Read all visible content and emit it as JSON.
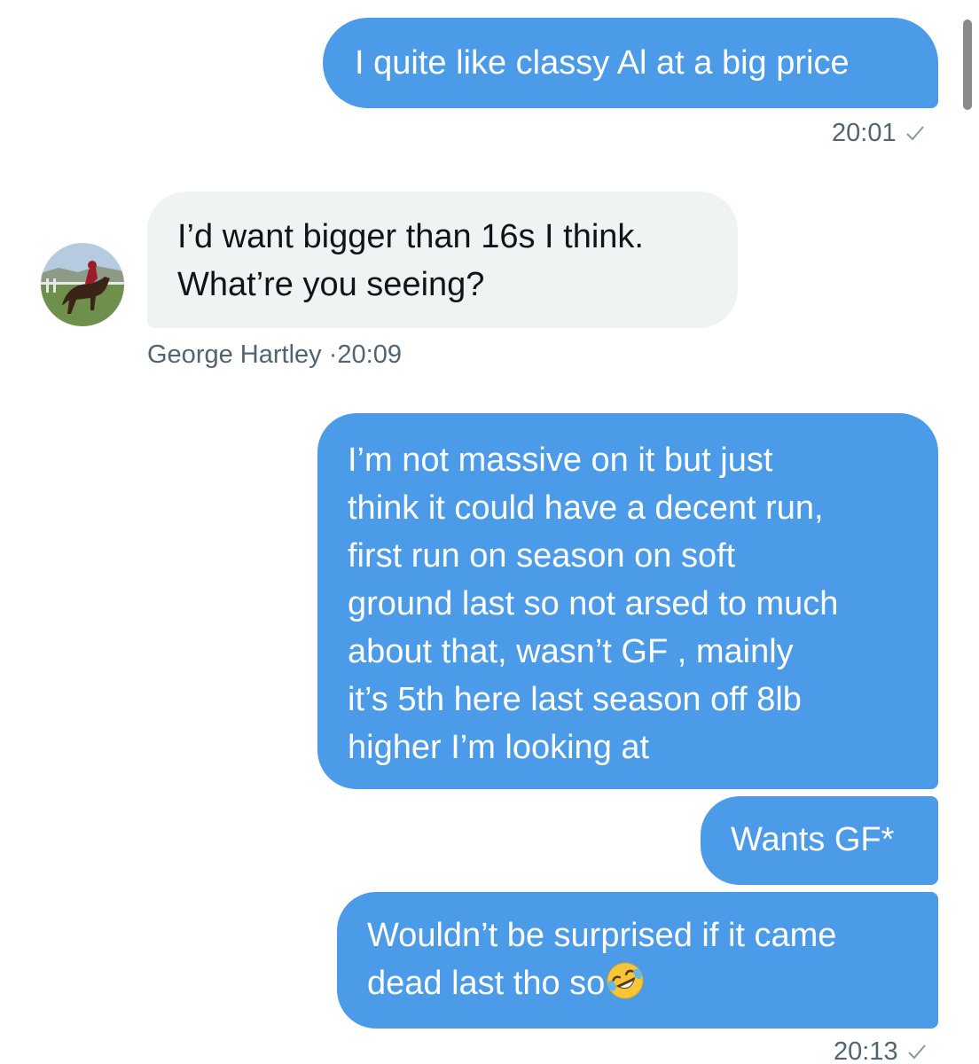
{
  "messages": [
    {
      "sender": "me",
      "lines": [
        "I quite like classy Al at a big price"
      ],
      "time": "20:01"
    },
    {
      "sender": "George Hartley",
      "lines": [
        "I’d want bigger than 16s I think.",
        "What’re you seeing?"
      ],
      "meta": "George Hartley",
      "time": "·20:09"
    },
    {
      "sender": "me",
      "lines": [
        "I’m not massive on it but just",
        "think it could have a decent run,",
        "first run on season on soft",
        "ground last so not arsed to much",
        "about that, wasn’t GF , mainly",
        "it’s 5th here last season off 8lb",
        "higher I’m looking at"
      ]
    },
    {
      "sender": "me",
      "lines": [
        "Wants GF*"
      ]
    },
    {
      "sender": "me",
      "lines": [
        "Wouldn’t be surprised if it came",
        "dead last tho so"
      ],
      "emoji": "rolling-on-floor-laughing",
      "time": "20:13"
    }
  ],
  "colors": {
    "outgoing_bubble": "#4c9be8",
    "incoming_bubble": "#eff3f4",
    "meta_text": "#536471"
  }
}
